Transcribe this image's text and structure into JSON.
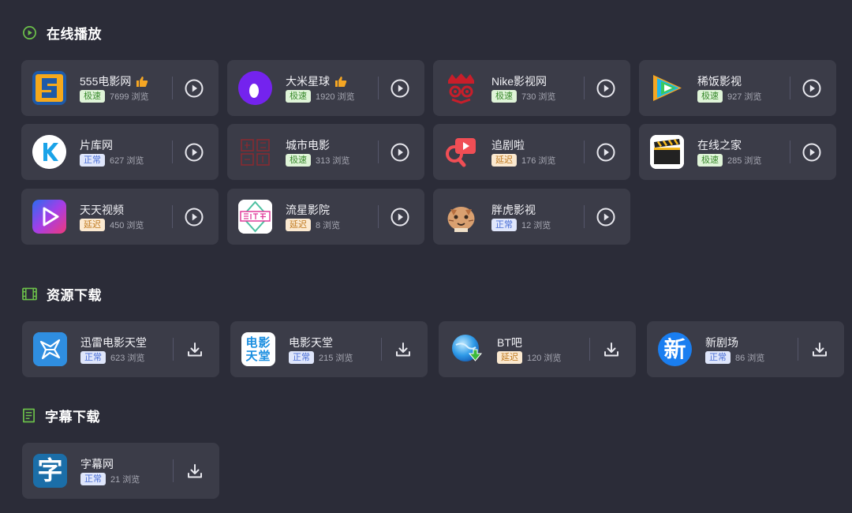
{
  "sections": {
    "online": {
      "title": "在线播放",
      "items": [
        {
          "name": "555电影网",
          "badge": "极速",
          "views": "7699 浏览",
          "icon": "logo-555"
        },
        {
          "name": "大米星球",
          "badge": "极速",
          "views": "1920 浏览",
          "icon": "logo-dami"
        },
        {
          "name": "Nike影视网",
          "badge": "极速",
          "views": "730 浏览",
          "icon": "logo-nike"
        },
        {
          "name": "稀饭影视",
          "badge": "极速",
          "views": "927 浏览",
          "icon": "logo-xifan"
        },
        {
          "name": "片库网",
          "badge": "正常",
          "views": "627 浏览",
          "icon": "logo-pianku"
        },
        {
          "name": "城市电影",
          "badge": "极速",
          "views": "313 浏览",
          "icon": "logo-chengshi"
        },
        {
          "name": "追剧啦",
          "badge": "延迟",
          "views": "176 浏览",
          "icon": "logo-zhuiju"
        },
        {
          "name": "在线之家",
          "badge": "极速",
          "views": "285 浏览",
          "icon": "logo-zaixian"
        },
        {
          "name": "天天视频",
          "badge": "延迟",
          "views": "450 浏览",
          "icon": "logo-tiantian"
        },
        {
          "name": "流星影院",
          "badge": "延迟",
          "views": "8 浏览",
          "icon": "logo-liuxing"
        },
        {
          "name": "胖虎影视",
          "badge": "正常",
          "views": "12 浏览",
          "icon": "logo-panghu"
        }
      ]
    },
    "download": {
      "title": "资源下载",
      "items": [
        {
          "name": "迅雷电影天堂",
          "badge": "正常",
          "views": "623 浏览",
          "icon": "logo-xunlei"
        },
        {
          "name": "电影天堂",
          "badge": "正常",
          "views": "215 浏览",
          "icon": "logo-dytt",
          "logo_text": "电影天堂"
        },
        {
          "name": "BT吧",
          "badge": "延迟",
          "views": "120 浏览",
          "icon": "logo-btba"
        },
        {
          "name": "新剧场",
          "badge": "正常",
          "views": "86 浏览",
          "icon": "logo-xinjuchang",
          "logo_text": "新"
        }
      ]
    },
    "subtitle": {
      "title": "字幕下载",
      "items": [
        {
          "name": "字幕网",
          "badge": "正常",
          "views": "21 浏览",
          "icon": "logo-zimu",
          "logo_text": "字"
        }
      ]
    }
  },
  "colors": {
    "background": "#2b2c38",
    "card": "#3b3c48",
    "section_icon": "#6cc04a",
    "thumb": "#f5a623"
  }
}
